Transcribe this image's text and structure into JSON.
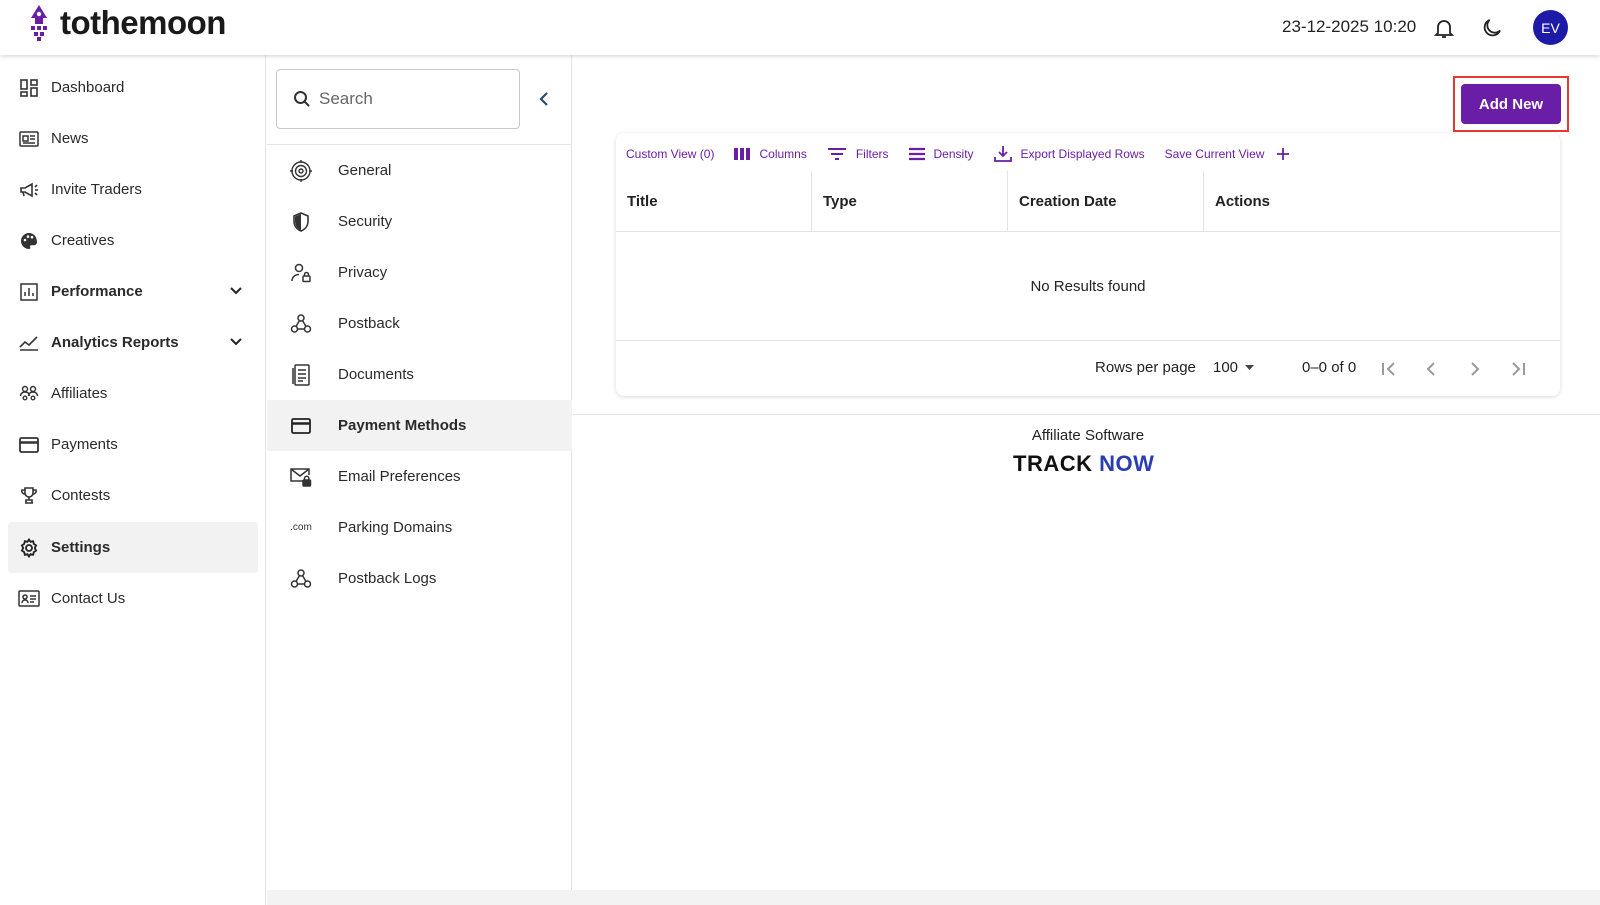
{
  "header": {
    "brand": "tothemoon",
    "datetime": "23-12-2025 10:20",
    "avatar_initials": "EV",
    "avatar_color": "#1d1aa8"
  },
  "sidebar": {
    "items": [
      {
        "label": "Dashboard",
        "icon": "dashboard-icon"
      },
      {
        "label": "News",
        "icon": "news-icon"
      },
      {
        "label": "Invite Traders",
        "icon": "megaphone-icon"
      },
      {
        "label": "Creatives",
        "icon": "palette-icon"
      },
      {
        "label": "Performance",
        "icon": "bar-chart-icon",
        "expandable": true
      },
      {
        "label": "Analytics Reports",
        "icon": "line-chart-icon",
        "expandable": true
      },
      {
        "label": "Affiliates",
        "icon": "group-icon"
      },
      {
        "label": "Payments",
        "icon": "card-icon"
      },
      {
        "label": "Contests",
        "icon": "trophy-icon"
      },
      {
        "label": "Settings",
        "icon": "gear-icon",
        "active": true
      },
      {
        "label": "Contact Us",
        "icon": "contact-icon"
      }
    ]
  },
  "submenu": {
    "search_placeholder": "Search",
    "items": [
      {
        "label": "General",
        "icon": "target-icon"
      },
      {
        "label": "Security",
        "icon": "shield-icon"
      },
      {
        "label": "Privacy",
        "icon": "person-lock-icon"
      },
      {
        "label": "Postback",
        "icon": "webhook-icon"
      },
      {
        "label": "Documents",
        "icon": "document-icon"
      },
      {
        "label": "Payment Methods",
        "icon": "card-icon",
        "active": true
      },
      {
        "label": "Email Preferences",
        "icon": "mail-lock-icon"
      },
      {
        "label": "Parking Domains",
        "icon": "dotcom-icon",
        "icon_text": ".com"
      },
      {
        "label": "Postback Logs",
        "icon": "webhook-icon"
      }
    ]
  },
  "main": {
    "add_button": "Add New",
    "accent_color": "#6a1ea8",
    "toolbar": {
      "custom_view": "Custom View (0)",
      "columns": "Columns",
      "filters": "Filters",
      "density": "Density",
      "export": "Export Displayed Rows",
      "save_view": "Save Current View"
    },
    "table": {
      "columns": [
        "Title",
        "Type",
        "Creation Date",
        "Actions"
      ],
      "empty_message": "No Results found"
    },
    "pagination": {
      "rows_per_page_label": "Rows per page",
      "rows_per_page_value": "100",
      "range": "0–0 of 0"
    }
  },
  "footer": {
    "label": "Affiliate Software",
    "brand_part1": "TRACK ",
    "brand_part2": "NOW"
  }
}
